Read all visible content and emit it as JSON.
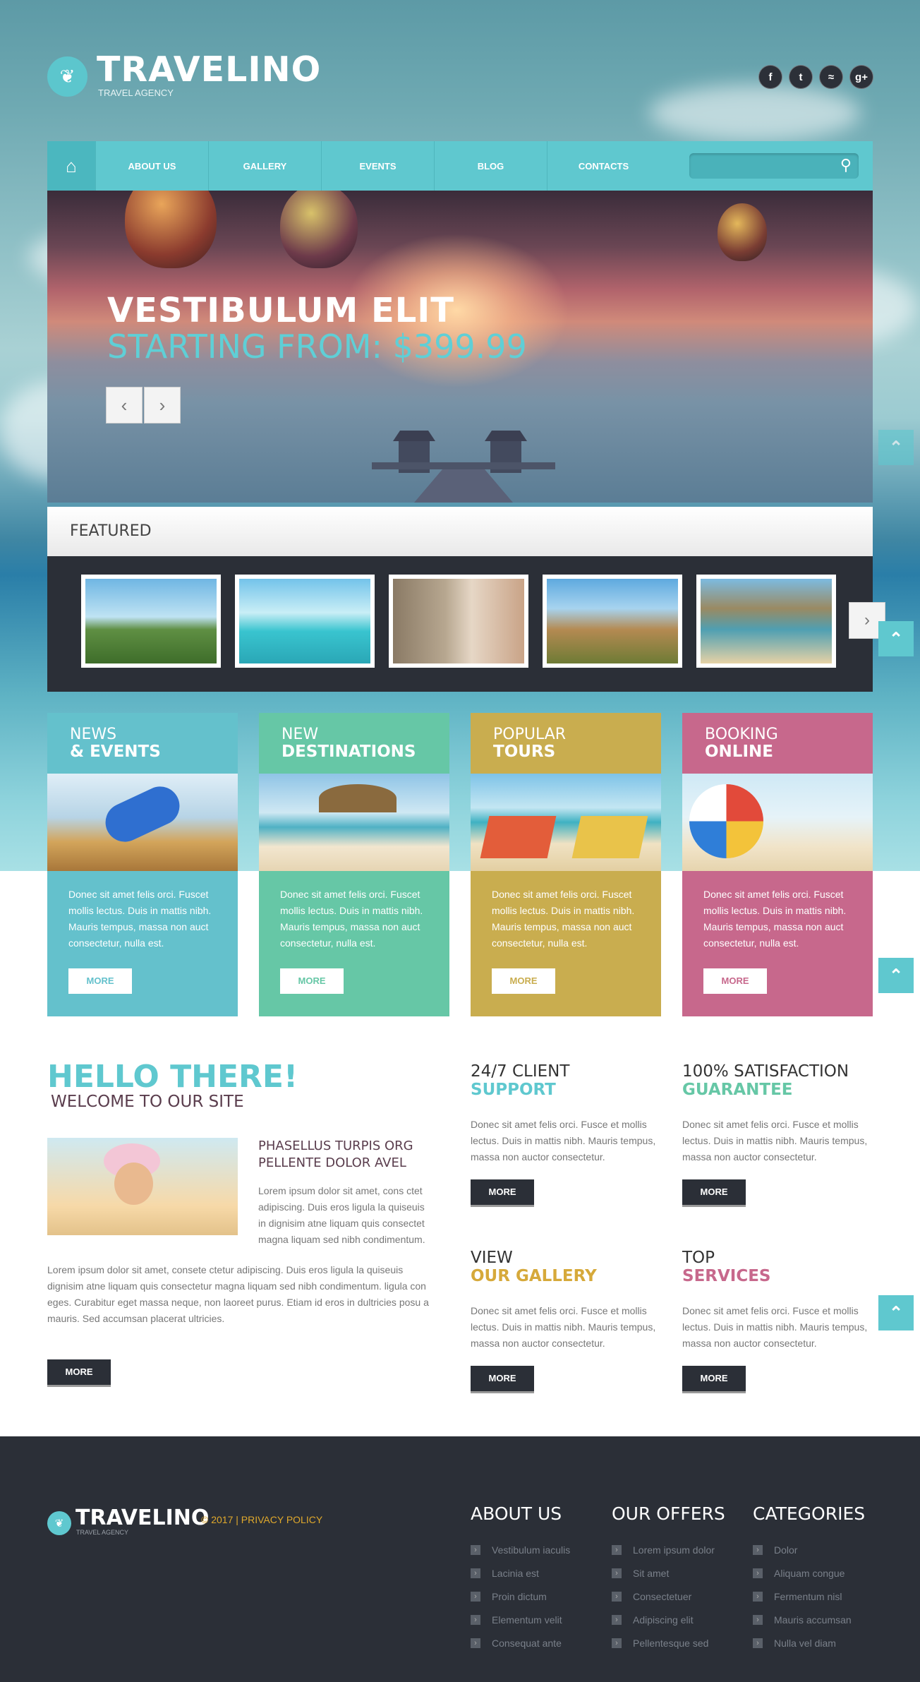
{
  "brand": {
    "name": "TRAVELINO",
    "tagline": "TRAVEL AGENCY"
  },
  "social": [
    {
      "icon": "facebook-icon",
      "glyph": "f"
    },
    {
      "icon": "twitter-icon",
      "glyph": "t"
    },
    {
      "icon": "rss-icon",
      "glyph": "≈"
    },
    {
      "icon": "google-plus-icon",
      "glyph": "g+"
    }
  ],
  "nav": {
    "home_glyph": "⌂",
    "items": [
      "ABOUT US",
      "GALLERY",
      "EVENTS",
      "BLOG",
      "CONTACTS"
    ],
    "search_placeholder": "",
    "search_glyph": "⚲"
  },
  "slider": {
    "title": "VESTIBULUM ELIT",
    "subtitle": "STARTING FROM: $399.99",
    "prev": "‹",
    "next": "›"
  },
  "featured": {
    "title": "FEATURED",
    "next": "›"
  },
  "scroll_top_glyph": "⌃",
  "boxes": [
    {
      "line1": "NEWS",
      "line2": "& EVENTS",
      "text": "Donec sit amet felis orci. Fuscet mollis lectus. Duis in mattis nibh. Mauris tempus, massa non auct consectetur, nulla est.",
      "button": "MORE",
      "color": "#64c1cc"
    },
    {
      "line1": "NEW",
      "line2": "DESTINATIONS",
      "text": "Donec sit amet felis orci. Fuscet mollis lectus. Duis in mattis nibh. Mauris tempus, massa non auct consectetur, nulla est.",
      "button": "MORE",
      "color": "#66c7a6"
    },
    {
      "line1": "POPULAR",
      "line2": "TOURS",
      "text": "Donec sit amet felis orci. Fuscet mollis lectus. Duis in mattis nibh. Mauris tempus, massa non auct consectetur, nulla est.",
      "button": "MORE",
      "color": "#c9ad4f"
    },
    {
      "line1": "BOOKING",
      "line2": "ONLINE",
      "text": "Donec sit amet felis orci. Fuscet mollis lectus. Duis in mattis nibh. Mauris tempus, massa non auct consectetur, nulla est.",
      "button": "MORE",
      "color": "#c7688c"
    }
  ],
  "welcome": {
    "hello": "HELLO THERE!",
    "sub": "WELCOME TO OUR SITE",
    "heading_line1": "PHASELLUS TURPIS ORG",
    "heading_line2": "PELLENTE DOLOR AVEL",
    "para1": "Lorem ipsum dolor sit amet, cons ctet adipiscing. Duis eros ligula la quiseuis in dignisim atne liquam quis consectet magna liquam sed nibh condimentum.",
    "para2": "Lorem ipsum dolor sit amet, consete ctetur adipiscing. Duis eros ligula la quiseuis dignisim atne liquam quis consectetur magna liquam sed nibh condimentum. ligula con eges. Curabitur eget massa neque, non laoreet purus. Etiam id eros in dultricies posu a mauris. Sed accumsan placerat ultricies.",
    "button": "MORE"
  },
  "features": [
    {
      "line1": "24/7 CLIENT",
      "line2": "SUPPORT",
      "accent": "#5fc8cf",
      "text": "Donec sit amet felis orci. Fusce et mollis lectus. Duis in mattis nibh. Mauris tempus, massa non auctor consectetur.",
      "button": "MORE"
    },
    {
      "line1": "100% SATISFACTION",
      "line2": "GUARANTEE",
      "accent": "#66c7a6",
      "text": "Donec sit amet felis orci. Fusce et mollis lectus. Duis in mattis nibh. Mauris tempus, massa non auctor consectetur.",
      "button": "MORE"
    },
    {
      "line1": "VIEW",
      "line2": "OUR GALLERY",
      "accent": "#d6a93a",
      "text": "Donec sit amet felis orci. Fusce et mollis lectus. Duis in mattis nibh. Mauris tempus, massa non auctor consectetur.",
      "button": "MORE"
    },
    {
      "line1": "TOP",
      "line2": "SERVICES",
      "accent": "#c7688c",
      "text": "Donec sit amet felis orci. Fusce et mollis lectus. Duis in mattis nibh. Mauris tempus, massa non auctor consectetur.",
      "button": "MORE"
    }
  ],
  "footer": {
    "brand": "TRAVELINO",
    "tagline": "TRAVEL AGENCY",
    "copyright": "© 2017 | PRIVACY POLICY",
    "columns": [
      {
        "title": "ABOUT US",
        "items": [
          "Vestibulum iaculis",
          "Lacinia est",
          "Proin dictum",
          "Elementum velit",
          "Consequat ante"
        ]
      },
      {
        "title": "OUR OFFERS",
        "items": [
          "Lorem ipsum dolor",
          "Sit amet",
          "Consectetuer",
          "Adipiscing elit",
          "Pellentesque sed"
        ]
      },
      {
        "title": "CATEGORIES",
        "items": [
          "Dolor",
          "Aliquam congue",
          "Fermentum nisl",
          "Mauris accumsan",
          "Nulla vel diam"
        ]
      }
    ]
  }
}
